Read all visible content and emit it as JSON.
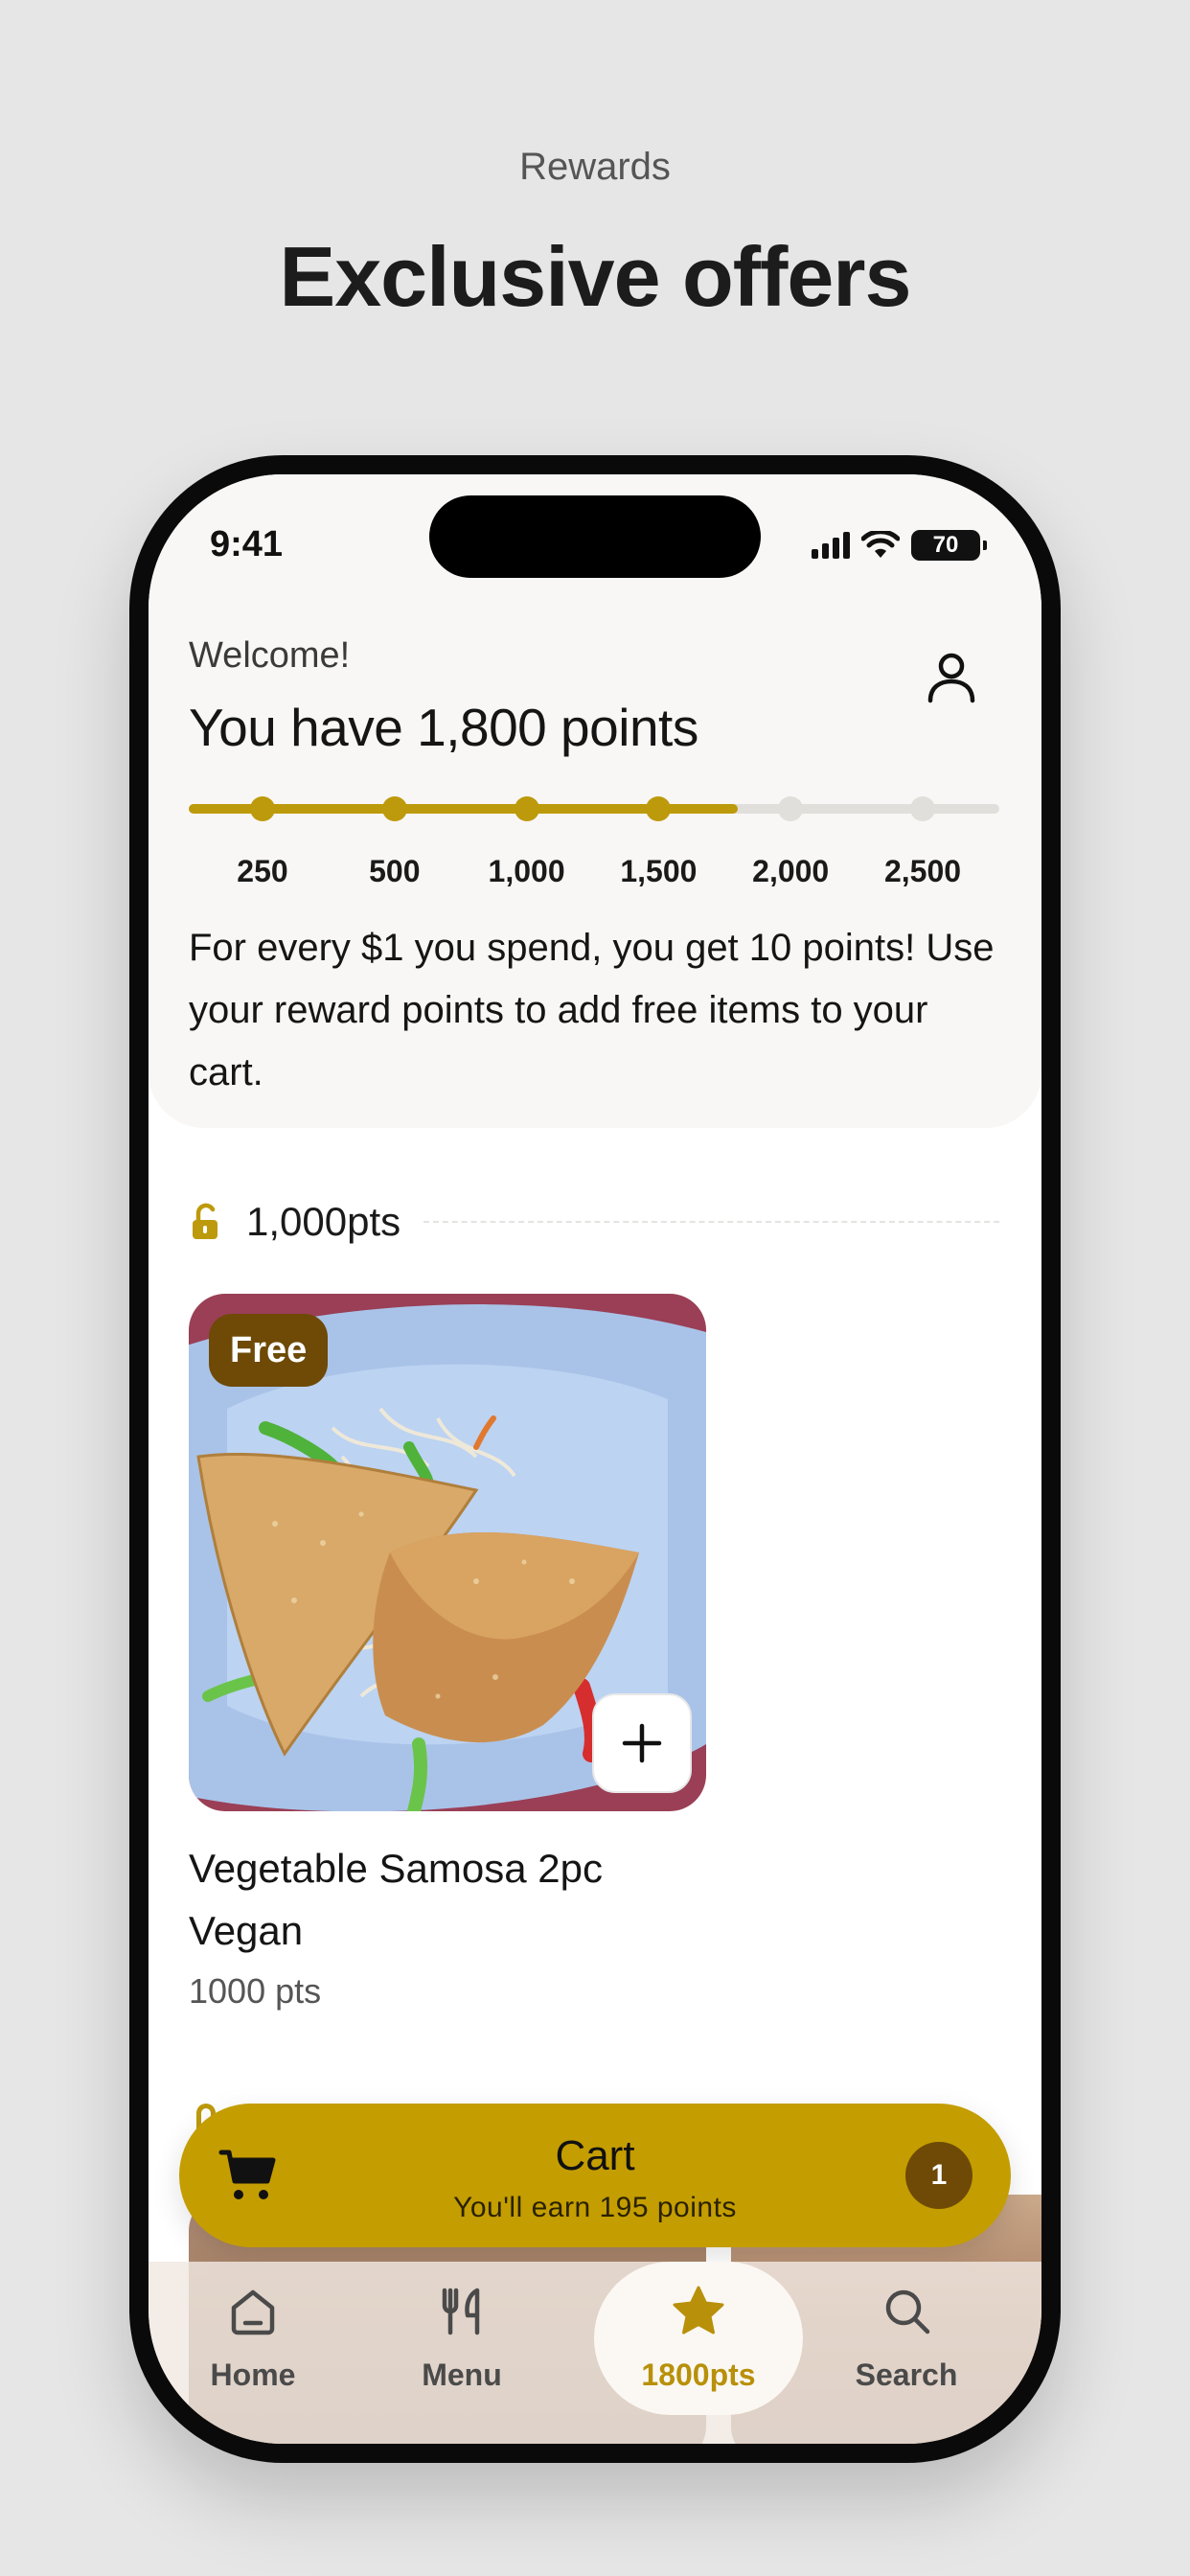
{
  "promo": {
    "subtitle": "Rewards",
    "title": "Exclusive offers"
  },
  "status_bar": {
    "time": "9:41",
    "battery": "70"
  },
  "header": {
    "welcome": "Welcome!",
    "points_heading": "You have 1,800 points",
    "profile_icon": "person-icon"
  },
  "progress": {
    "current_points": 1800,
    "max_points": 2500,
    "milestones": [
      {
        "label": "250",
        "reached": true
      },
      {
        "label": "500",
        "reached": true
      },
      {
        "label": "1,000",
        "reached": true
      },
      {
        "label": "1,500",
        "reached": true
      },
      {
        "label": "2,000",
        "reached": false
      },
      {
        "label": "2,500",
        "reached": false
      }
    ],
    "fill_color": "#bd9a0c",
    "track_color": "#e1dfdb"
  },
  "info": {
    "text": "For every $1 you spend, you get 10 points! Use your reward points to add free items to your cart."
  },
  "tier": {
    "label": "1,000pts",
    "icon": "unlock-icon"
  },
  "product": {
    "badge": "Free",
    "name": "Vegetable Samosa 2pc Vegan",
    "points": "1000 pts",
    "add_icon": "plus-icon"
  },
  "cart": {
    "title": "Cart",
    "subtitle": "You'll earn 195 points",
    "count": "1",
    "icon": "cart-icon",
    "color": "#c49d00"
  },
  "tabs": [
    {
      "label": "Home",
      "icon": "home-icon",
      "active": false
    },
    {
      "label": "Menu",
      "icon": "utensils-icon",
      "active": false
    },
    {
      "label": "1800pts",
      "icon": "star-icon",
      "active": true
    },
    {
      "label": "Search",
      "icon": "search-icon",
      "active": false
    }
  ],
  "colors": {
    "accent": "#c49d00",
    "badge": "#6e4a06",
    "active_tab_text": "#b8900a"
  }
}
